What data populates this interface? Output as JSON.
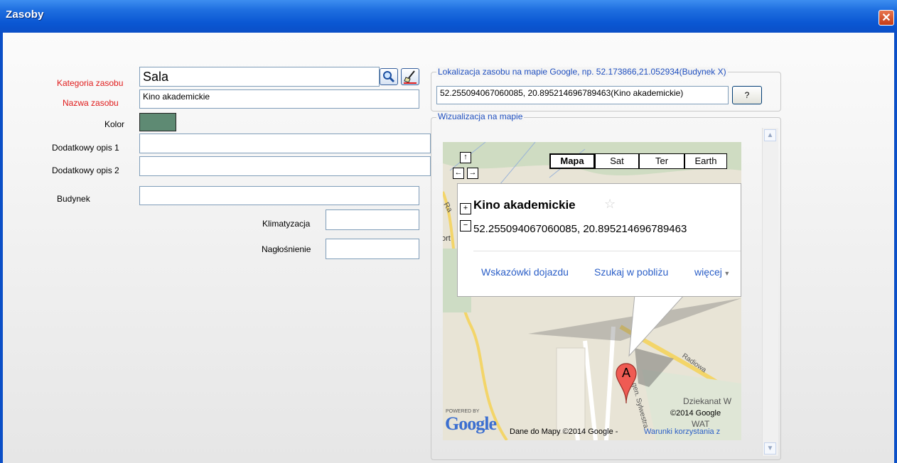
{
  "window": {
    "title": "Zasoby",
    "close_label": "✕"
  },
  "form": {
    "kategoria": {
      "label": "Kategoria zasobu",
      "value": "Sala"
    },
    "nazwa": {
      "label": "Nazwa zasobu",
      "value": "Kino akademickie"
    },
    "kolor": {
      "label": "Kolor",
      "value": "#5e8a73"
    },
    "opis1": {
      "label": "Dodatkowy opis 1",
      "value": ""
    },
    "opis2": {
      "label": "Dodatkowy opis 2",
      "value": ""
    },
    "budynek": {
      "label": "Budynek",
      "value": ""
    },
    "klimatyzacja": {
      "label": "Klimatyzacja",
      "value": ""
    },
    "naglosnienie": {
      "label": "Nagłośnienie",
      "value": ""
    }
  },
  "location": {
    "legend": "Lokalizacja zasobu na mapie Google, np. 52.173866,21.052934(Budynek X)",
    "value": "52.255094067060085, 20.895214696789463(Kino akademickie)",
    "help_label": "?"
  },
  "map": {
    "legend": "Wizualizacja na mapie",
    "types": [
      "Mapa",
      "Sat",
      "Ter",
      "Earth"
    ],
    "selected_type": "Mapa",
    "nav": {
      "up": "↑",
      "left": "←",
      "right": "→",
      "down": "↓",
      "zoom_in": "+",
      "zoom_out": "−"
    },
    "info": {
      "title": "Kino akademickie",
      "coords": "52.255094067060085, 20.895214696789463",
      "links": [
        "Wskazówki dojazdu",
        "Szukaj w pobliżu",
        "więcej"
      ]
    },
    "marker_label": "A",
    "labels": {
      "radiowa": "Radiowa",
      "sylwestra": "gen. Sylwestra",
      "dziekanat": "Dziekanat W",
      "wat": "WAT",
      "ort": "ort",
      "ra": "Ra"
    },
    "copyright": "©2014 Google",
    "powered_by": "POWERED BY",
    "logo": "Google",
    "attribution": "Dane do Mapy ©2014 Google -",
    "terms_link": "Warunki korzystania z"
  },
  "colors": {
    "titlebar": "#0b4fc7",
    "required_label": "#e01b1b",
    "legend": "#1f4fbf",
    "link": "#2a5ec7"
  }
}
